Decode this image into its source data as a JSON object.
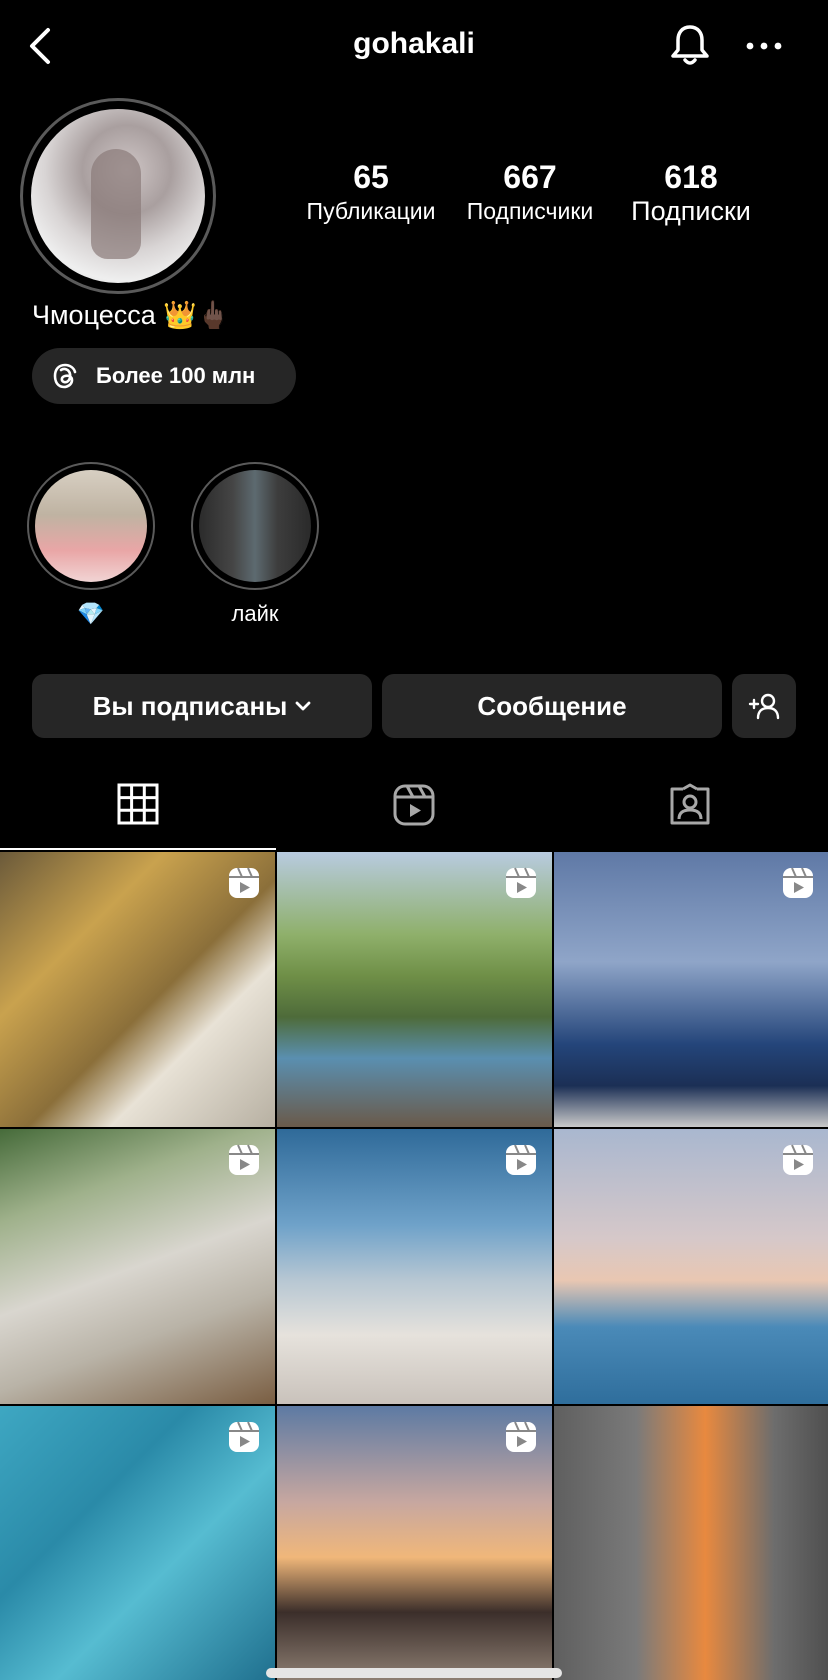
{
  "header": {
    "username": "gohakali"
  },
  "profile": {
    "display_name": "Чмоцесса 👑🖕🏿",
    "threads_badge": "Более 100 млн",
    "stats": {
      "posts_count": "65",
      "posts_label": "Публикации",
      "followers_count": "667",
      "followers_label": "Подписчики",
      "following_count": "618",
      "following_label": "Подписки"
    }
  },
  "highlights": [
    {
      "label": "💎"
    },
    {
      "label": "лайк"
    }
  ],
  "actions": {
    "follow_label": "Вы подписаны",
    "message_label": "Сообщение"
  },
  "tabs": [
    "grid-icon",
    "reels-icon",
    "tagged-icon"
  ],
  "icons": {
    "back": "chevron-left-icon",
    "notifications": "bell-icon",
    "more": "more-horizontal-icon",
    "threads": "threads-icon",
    "add_person": "add-person-icon",
    "reel": "reel-icon"
  },
  "colors": {
    "background": "#000000",
    "surface": "#262626",
    "text": "#ffffff"
  }
}
